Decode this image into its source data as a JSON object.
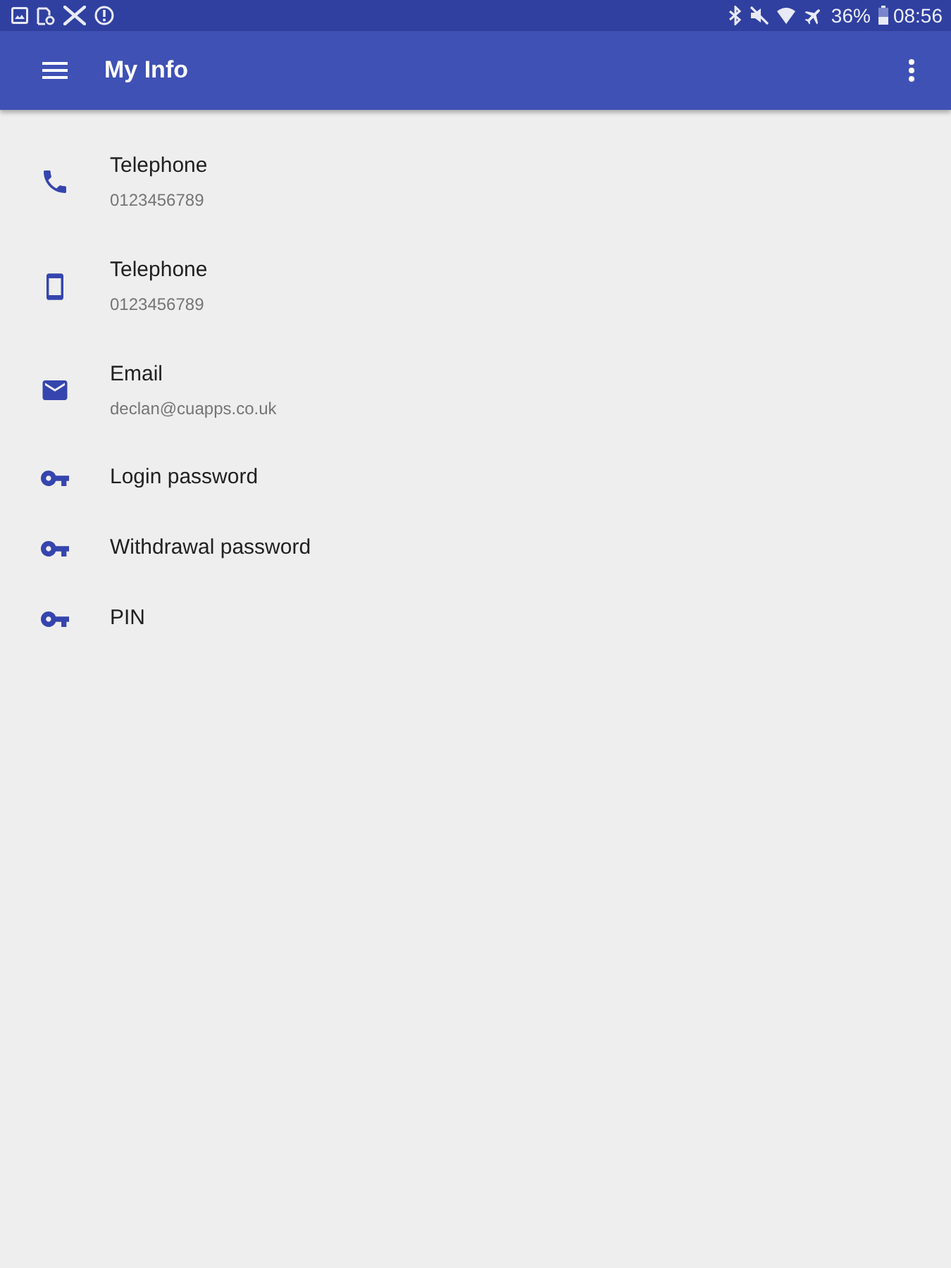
{
  "status_bar": {
    "battery": "36%",
    "time": "08:56"
  },
  "app_bar": {
    "title": "My Info"
  },
  "items": [
    {
      "kind": "phone",
      "title": "Telephone",
      "subtitle": "0123456789"
    },
    {
      "kind": "mobile",
      "title": "Telephone",
      "subtitle": "0123456789"
    },
    {
      "kind": "email",
      "title": "Email",
      "subtitle": "declan@cuapps.co.uk"
    },
    {
      "kind": "password",
      "title": "Login password"
    },
    {
      "kind": "password",
      "title": "Withdrawal password"
    },
    {
      "kind": "password",
      "title": "PIN"
    }
  ]
}
